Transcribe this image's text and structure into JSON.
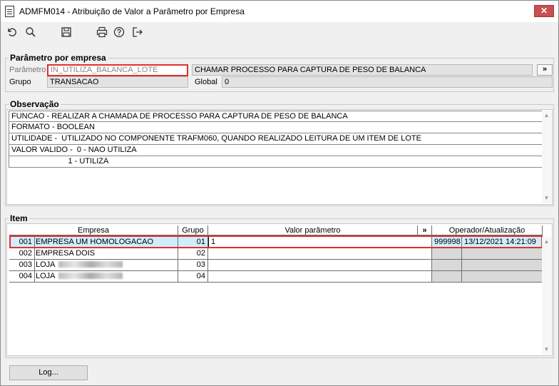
{
  "window": {
    "title": "ADMFM014 - Atribuição de Valor a Parâmetro por Empresa",
    "close_label": "✕"
  },
  "toolbar": {
    "undo_icon": "undo-icon",
    "search_icon": "search-icon",
    "save_icon": "save-icon",
    "print_icon": "printer-icon",
    "help_icon": "help-icon",
    "exit_icon": "exit-icon"
  },
  "parametro_group": {
    "title": "Parâmetro por empresa",
    "parametro_label": "Parâmetro",
    "parametro_value": "IN_UTILIZA_BALANCA_LOTE",
    "descricao_value": "CHAMAR PROCESSO PARA CAPTURA DE PESO DE BALANCA",
    "expand_label": "»",
    "grupo_label": "Grupo",
    "grupo_value": "TRANSACAO",
    "global_label": "Global",
    "global_value": "0"
  },
  "observacao_group": {
    "title": "Observação",
    "lines": [
      "FUNCAO - REALIZAR A CHAMADA DE PROCESSO PARA CAPTURA DE PESO DE BALANCA",
      "FORMATO - BOOLEAN",
      "UTILIDADE -  UTILIZADO NO COMPONENTE TRAFM060, QUANDO REALIZADO LEITURA DE UM ITEM DE LOTE",
      "VALOR VALIDO -  0 - NAO UTILIZA",
      "                          1 - UTILIZA"
    ]
  },
  "item_group": {
    "title": "Item",
    "columns": {
      "empresa": "Empresa",
      "grupo": "Grupo",
      "valor": "Valor parâmetro",
      "expand": "»",
      "operador": "Operador/Atualização"
    },
    "rows": [
      {
        "code": "001",
        "empresa": "EMPRESA UM HOMOLOGACAO",
        "grupo": "01",
        "valor": "1",
        "operador": "999998",
        "data": "13/12/2021 14:21:09"
      },
      {
        "code": "002",
        "empresa": "EMPRESA DOIS",
        "grupo": "02",
        "valor": "",
        "operador": "",
        "data": ""
      },
      {
        "code": "003",
        "empresa": "LOJA",
        "grupo": "03",
        "valor": "",
        "operador": "",
        "data": ""
      },
      {
        "code": "004",
        "empresa": "LOJA",
        "grupo": "04",
        "valor": "",
        "operador": "",
        "data": ""
      }
    ]
  },
  "footer": {
    "log_label": "Log..."
  }
}
